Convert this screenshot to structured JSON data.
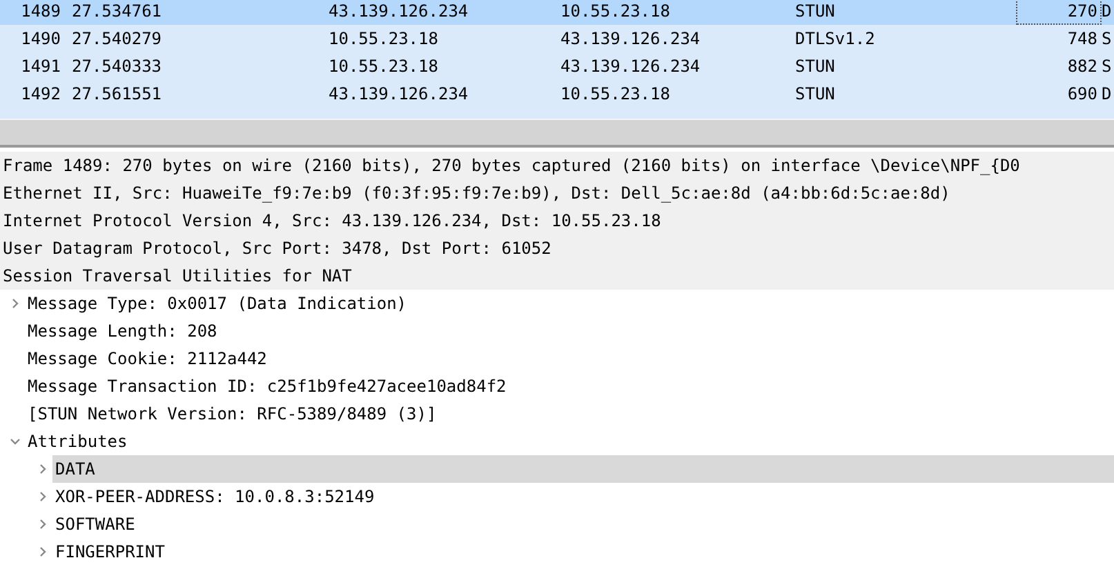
{
  "packets": [
    {
      "no": "1489",
      "time": "27.534761",
      "source": "43.139.126.234",
      "destination": "10.55.23.18",
      "protocol": "STUN",
      "length": "270",
      "info": "D",
      "selected": true
    },
    {
      "no": "1490",
      "time": "27.540279",
      "source": "10.55.23.18",
      "destination": "43.139.126.234",
      "protocol": "DTLSv1.2",
      "length": "748",
      "info": "S",
      "selected": false
    },
    {
      "no": "1491",
      "time": "27.540333",
      "source": "10.55.23.18",
      "destination": "43.139.126.234",
      "protocol": "STUN",
      "length": "882",
      "info": "S",
      "selected": false
    },
    {
      "no": "1492",
      "time": "27.561551",
      "source": "43.139.126.234",
      "destination": "10.55.23.18",
      "protocol": "STUN",
      "length": "690",
      "info": "D",
      "selected": false
    }
  ],
  "details": [
    {
      "text": "Frame 1489: 270 bytes on wire (2160 bits), 270 bytes captured (2160 bits) on interface \\Device\\NPF_{D0",
      "selected": false
    },
    {
      "text": "Ethernet II, Src: HuaweiTe_f9:7e:b9 (f0:3f:95:f9:7e:b9), Dst: Dell_5c:ae:8d (a4:bb:6d:5c:ae:8d)",
      "selected": false
    },
    {
      "text": "Internet Protocol Version 4, Src: 43.139.126.234, Dst: 10.55.23.18",
      "selected": false
    },
    {
      "text": "User Datagram Protocol, Src Port: 3478, Dst Port: 61052",
      "selected": false
    },
    {
      "text": "Session Traversal Utilities for NAT",
      "selected": false,
      "children": [
        {
          "text": "Message Type: 0x0017 (Data Indication)",
          "expanded": false,
          "selected": false
        },
        {
          "text": "Message Length: 208",
          "selected": false
        },
        {
          "text": "Message Cookie: 2112a442",
          "selected": false
        },
        {
          "text": "Message Transaction ID: c25f1b9fe427acee10ad84f2",
          "selected": false
        },
        {
          "text": "[STUN Network Version: RFC-5389/8489 (3)]",
          "selected": false
        },
        {
          "text": "Attributes",
          "expanded": true,
          "selected": false,
          "children": [
            {
              "text": "DATA",
              "expanded": false,
              "selected": true
            },
            {
              "text": "XOR-PEER-ADDRESS: 10.0.8.3:52149",
              "expanded": false,
              "selected": false
            },
            {
              "text": "SOFTWARE",
              "expanded": false,
              "selected": false
            },
            {
              "text": "FINGERPRINT",
              "expanded": false,
              "selected": false
            }
          ]
        }
      ]
    }
  ]
}
